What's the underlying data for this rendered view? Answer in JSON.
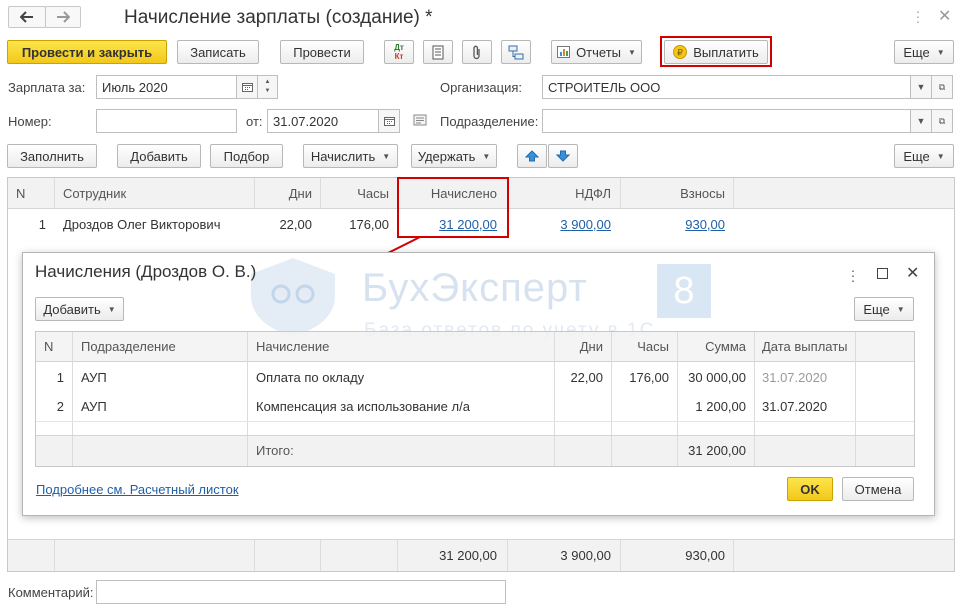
{
  "window": {
    "title": "Начисление зарплаты (создание) *"
  },
  "toolbar": {
    "post_close": "Провести и закрыть",
    "save": "Записать",
    "post": "Провести",
    "reports": "Отчеты",
    "pay": "Выплатить",
    "more": "Еще",
    "dtkt_top": "Дт",
    "dtkt_bottom": "Кт"
  },
  "form": {
    "salary_for_label": "Зарплата за:",
    "salary_for_value": "Июль 2020",
    "org_label": "Организация:",
    "org_value": "СТРОИТЕЛЬ ООО",
    "number_label": "Номер:",
    "number_value": "",
    "from_label": "от:",
    "date_value": "31.07.2020",
    "division_label": "Подразделение:",
    "division_value": "",
    "comment_label": "Комментарий:",
    "comment_value": ""
  },
  "table_toolbar": {
    "fill": "Заполнить",
    "add": "Добавить",
    "select": "Подбор",
    "accrue": "Начислить",
    "withhold": "Удержать",
    "more": "Еще"
  },
  "main_table": {
    "headers": {
      "n": "N",
      "employee": "Сотрудник",
      "days": "Дни",
      "hours": "Часы",
      "accrued": "Начислено",
      "ndfl": "НДФЛ",
      "contrib": "Взносы"
    },
    "rows": [
      {
        "n": "1",
        "employee": "Дроздов Олег Викторович",
        "days": "22,00",
        "hours": "176,00",
        "accrued": "31 200,00",
        "ndfl": "3 900,00",
        "contrib": "930,00"
      }
    ],
    "totals": {
      "accrued": "31 200,00",
      "ndfl": "3 900,00",
      "contrib": "930,00"
    }
  },
  "watermark": {
    "brand": "БухЭксперт",
    "num": "8",
    "tagline": "База ответов по учету в 1С"
  },
  "dialog": {
    "title": "Начисления (Дроздов О. В.)",
    "add": "Добавить",
    "more": "Еще",
    "headers": {
      "n": "N",
      "division": "Подразделение",
      "accrual": "Начисление",
      "days": "Дни",
      "hours": "Часы",
      "sum": "Сумма",
      "pay_date": "Дата выплаты"
    },
    "rows": [
      {
        "n": "1",
        "division": "АУП",
        "accrual": "Оплата по окладу",
        "days": "22,00",
        "hours": "176,00",
        "sum": "30 000,00",
        "pay_date": "31.07.2020"
      },
      {
        "n": "2",
        "division": "АУП",
        "accrual": "Компенсация за использование л/а",
        "days": "",
        "hours": "",
        "sum": "1 200,00",
        "pay_date": "31.07.2020"
      }
    ],
    "total_label": "Итого:",
    "total_sum": "31 200,00",
    "link": "Подробнее см. Расчетный листок",
    "ok": "OK",
    "cancel": "Отмена"
  },
  "colors": {
    "accent_yellow": "#f6d21f",
    "highlight_red": "#d40000",
    "link_blue": "#1f5fa8",
    "arrow_blue": "#3a8fd6"
  },
  "icons": [
    "back-arrow-icon",
    "forward-arrow-icon",
    "dt-kt-icon",
    "document-list-icon",
    "paperclip-icon",
    "structure-icon",
    "report-chart-icon",
    "ruble-coin-icon",
    "calendar-icon",
    "dropdown-icon",
    "open-icon",
    "up-arrow-icon",
    "down-arrow-icon",
    "more-vertical-icon",
    "close-icon",
    "maximize-icon"
  ]
}
